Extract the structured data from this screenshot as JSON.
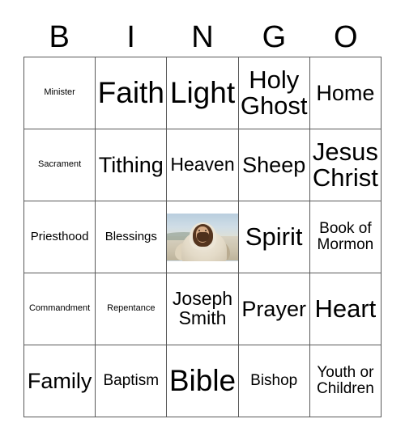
{
  "card": {
    "header_letters": [
      "B",
      "I",
      "N",
      "G",
      "O"
    ],
    "rows": [
      [
        {
          "text": "Minister",
          "size": "xs"
        },
        {
          "text": "Faith",
          "size": "max"
        },
        {
          "text": "Light",
          "size": "max"
        },
        {
          "text": "Holy Ghost",
          "size": "xxl"
        },
        {
          "text": "Home",
          "size": "xl"
        }
      ],
      [
        {
          "text": "Sacrament",
          "size": "xs"
        },
        {
          "text": "Tithing",
          "size": "xl"
        },
        {
          "text": "Heaven",
          "size": "l"
        },
        {
          "text": "Sheep",
          "size": "xl"
        },
        {
          "text": "Jesus Christ",
          "size": "xxl"
        }
      ],
      [
        {
          "text": "Priesthood",
          "size": "s"
        },
        {
          "text": "Blessings",
          "size": "s"
        },
        {
          "text": "",
          "size": "s",
          "type": "image",
          "image_alt": "jesus-christ-photo"
        },
        {
          "text": "Spirit",
          "size": "xxl"
        },
        {
          "text": "Book of Mormon",
          "size": "m"
        }
      ],
      [
        {
          "text": "Commandment",
          "size": "xs"
        },
        {
          "text": "Repentance",
          "size": "xs"
        },
        {
          "text": "Joseph Smith",
          "size": "l"
        },
        {
          "text": "Prayer",
          "size": "xl"
        },
        {
          "text": "Heart",
          "size": "xxl"
        }
      ],
      [
        {
          "text": "Family",
          "size": "xl"
        },
        {
          "text": "Baptism",
          "size": "m"
        },
        {
          "text": "Bible",
          "size": "max"
        },
        {
          "text": "Bishop",
          "size": "m"
        },
        {
          "text": "Youth or Children",
          "size": "m"
        }
      ]
    ]
  },
  "colors": {
    "background": "#ffffff",
    "text": "#000000",
    "grid_line": "#595959"
  }
}
